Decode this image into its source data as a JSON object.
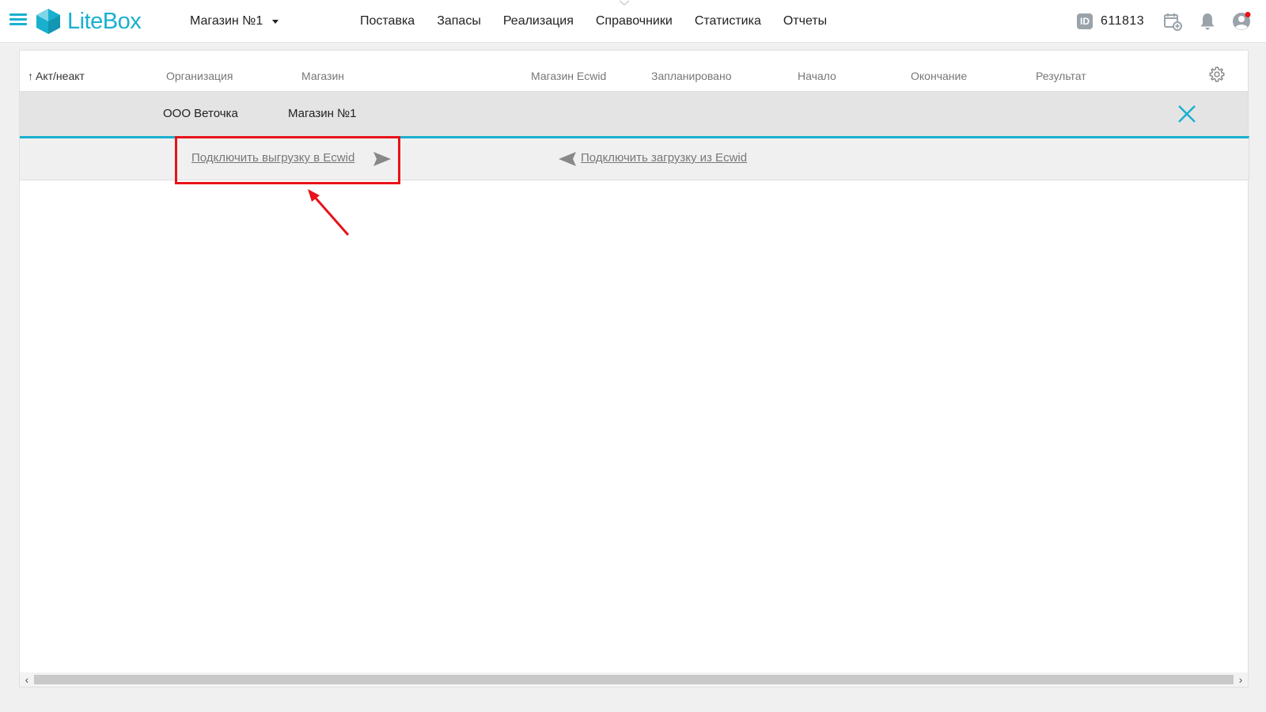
{
  "header": {
    "logo_text": "LiteBox",
    "store_selected": "Магазин №1",
    "nav": [
      "Поставка",
      "Запасы",
      "Реализация",
      "Справочники",
      "Статистика",
      "Отчеты"
    ],
    "id_badge": "ID",
    "id_value": "611813"
  },
  "table": {
    "columns": {
      "active": "Акт/неакт",
      "organization": "Организация",
      "store": "Магазин",
      "ecwid_store": "Магазин Ecwid",
      "scheduled": "Запланировано",
      "start": "Начало",
      "end": "Окончание",
      "result": "Результат"
    },
    "sort_arrow": "↑",
    "row": {
      "organization": "ООО Веточка",
      "store": "Магазин №1"
    }
  },
  "expanded": {
    "export_link": "Подключить выгрузку в Ecwid",
    "import_link": "Подключить загрузку из Ecwid"
  },
  "scrollbar": {
    "left": "‹",
    "right": "›"
  },
  "colors": {
    "accent": "#19b0cf",
    "annotation": "#e8121a"
  }
}
